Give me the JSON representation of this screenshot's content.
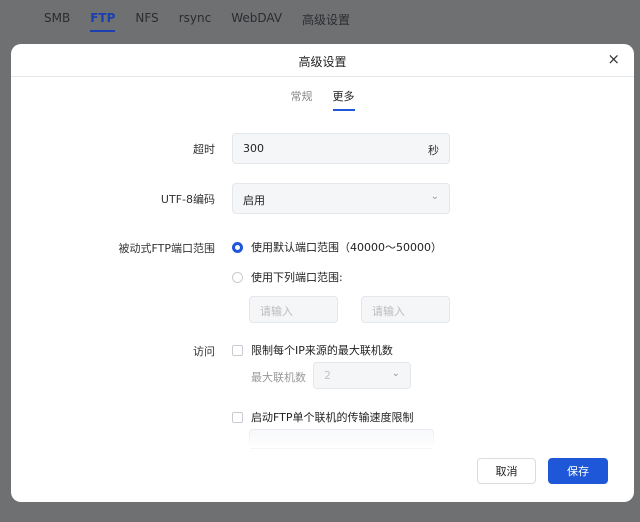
{
  "background_tabs": [
    "SMB",
    "FTP",
    "NFS",
    "rsync",
    "WebDAV",
    "高级设置"
  ],
  "background_active_tab": "FTP",
  "modal": {
    "title": "高级设置",
    "close_symbol": "×",
    "subtabs": [
      "常规",
      "更多"
    ],
    "active_subtab": "更多"
  },
  "timeout": {
    "label": "超时",
    "value": "300",
    "unit": "秒"
  },
  "utf8": {
    "label": "UTF-8编码",
    "value": "启用"
  },
  "passive": {
    "label": "被动式FTP端口范围",
    "option_default": "使用默认端口范围（40000～50000）",
    "option_custom": "使用下列端口范围:",
    "placeholder_from": "请输入",
    "placeholder_to": "请输入"
  },
  "access": {
    "label": "访问",
    "limit_ip_label": "限制每个IP来源的最大联机数",
    "max_conn_label": "最大联机数",
    "max_conn_value": "2",
    "speed_limit_label": "启动FTP单个联机的传输速度限制"
  },
  "footer": {
    "cancel": "取消",
    "save": "保存"
  },
  "colors": {
    "accent": "#1e58d8",
    "backdrop": "#6e7072"
  }
}
